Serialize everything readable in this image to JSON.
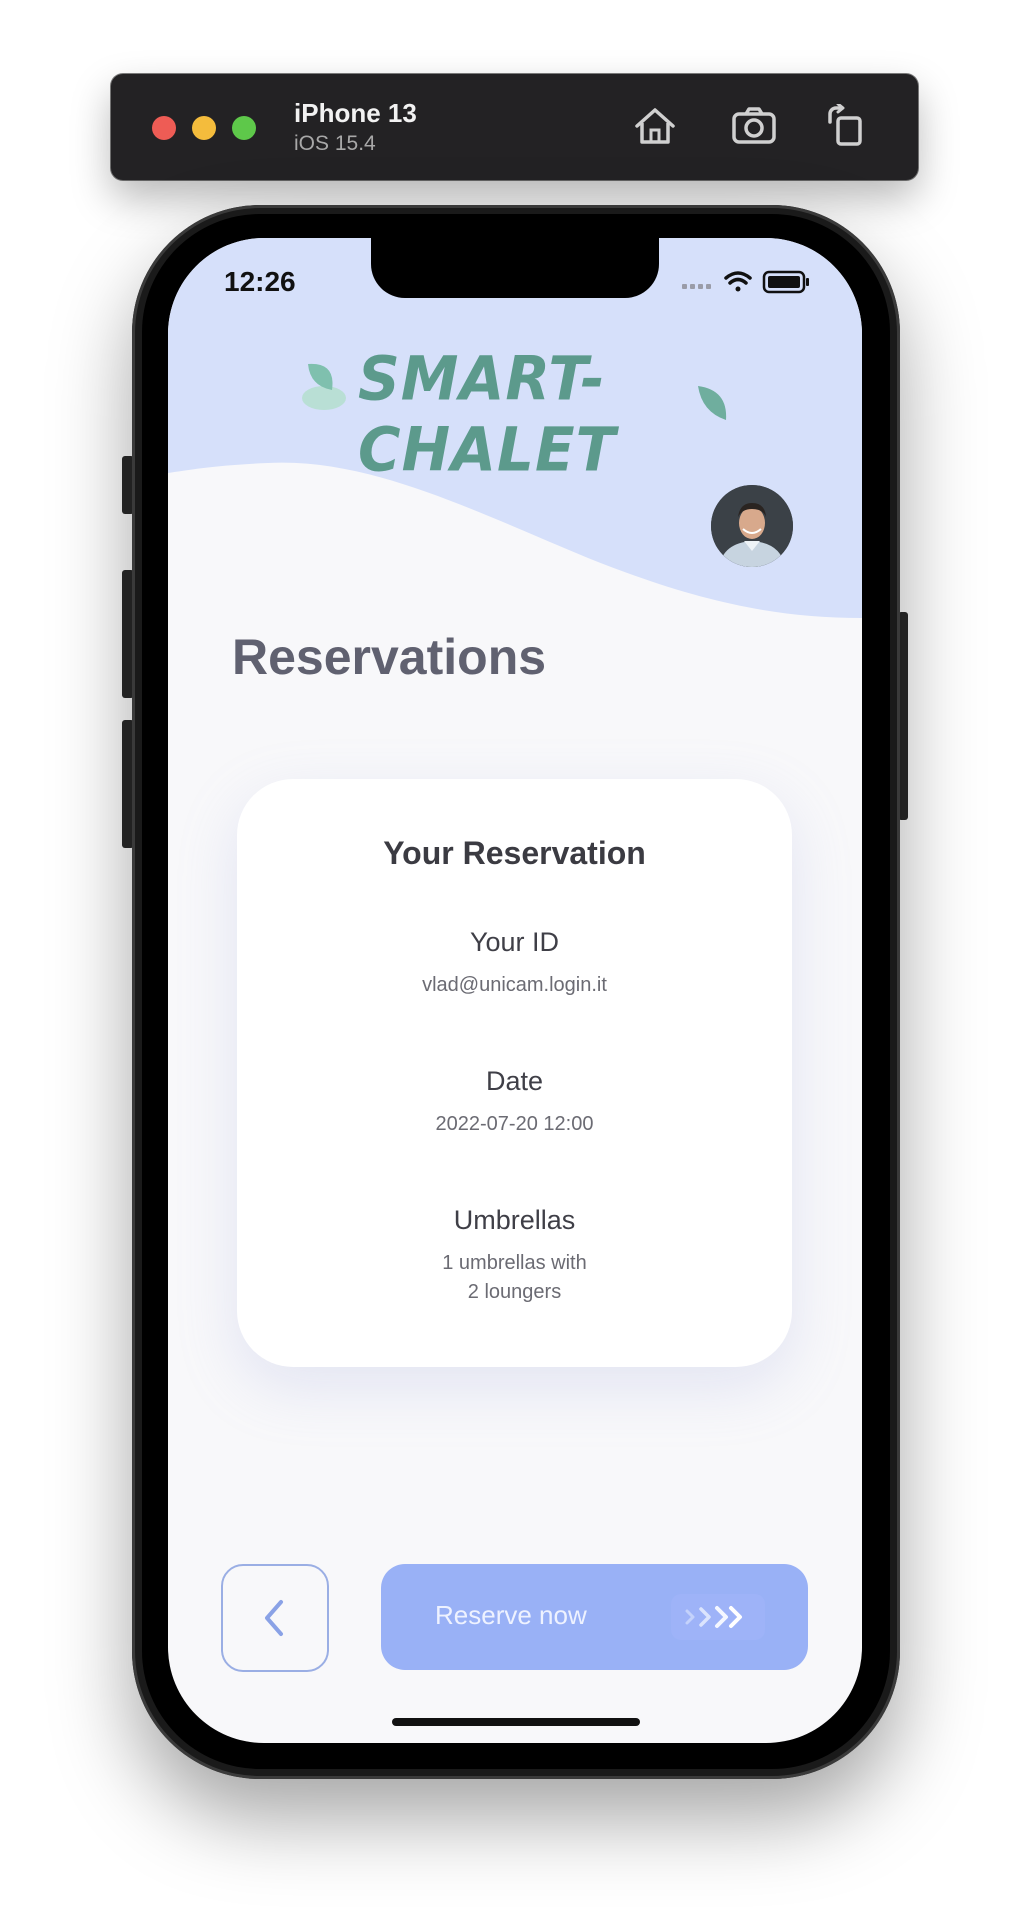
{
  "simulator": {
    "device_name": "iPhone 13",
    "os_version": "iOS 15.4",
    "icons": [
      "home-icon",
      "screenshot-icon",
      "rotate-icon"
    ]
  },
  "status_bar": {
    "time": "12:26",
    "icons": [
      "signal-icon",
      "wifi-icon",
      "battery-icon"
    ]
  },
  "app": {
    "logo_text": "SMART-CHALET",
    "page_title": "Reservations",
    "colors": {
      "header": "#d6e0fa",
      "logo": "#5c9a8c",
      "button": "#99b1f6",
      "title": "#606170"
    }
  },
  "reservation": {
    "title": "Your Reservation",
    "id_label": "Your ID",
    "id_value": "vlad@unicam.login.it",
    "date_label": "Date",
    "date_value": "2022-07-20 12:00",
    "umbrellas_label": "Umbrellas",
    "umbrellas_value_line1": "1 umbrellas with",
    "umbrellas_value_line2": "2 loungers"
  },
  "actions": {
    "back_icon": "chevron-left-icon",
    "reserve_label": "Reserve now",
    "reserve_icon": "double-chevron-right-icon"
  }
}
